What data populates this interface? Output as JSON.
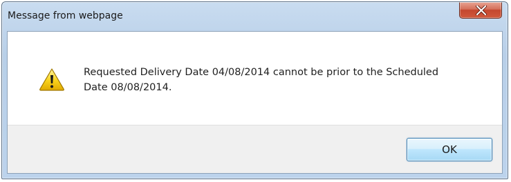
{
  "dialog": {
    "title": "Message from webpage",
    "message": "Requested Delivery Date 04/08/2014 cannot be prior to the Scheduled\nDate 08/08/2014.",
    "icon": "warning-icon",
    "ok_label": "OK",
    "close_icon": "close-icon"
  },
  "colors": {
    "close_button": "#c4472f",
    "ok_border": "#3c7fb1",
    "warning_yellow": "#f5c400"
  }
}
